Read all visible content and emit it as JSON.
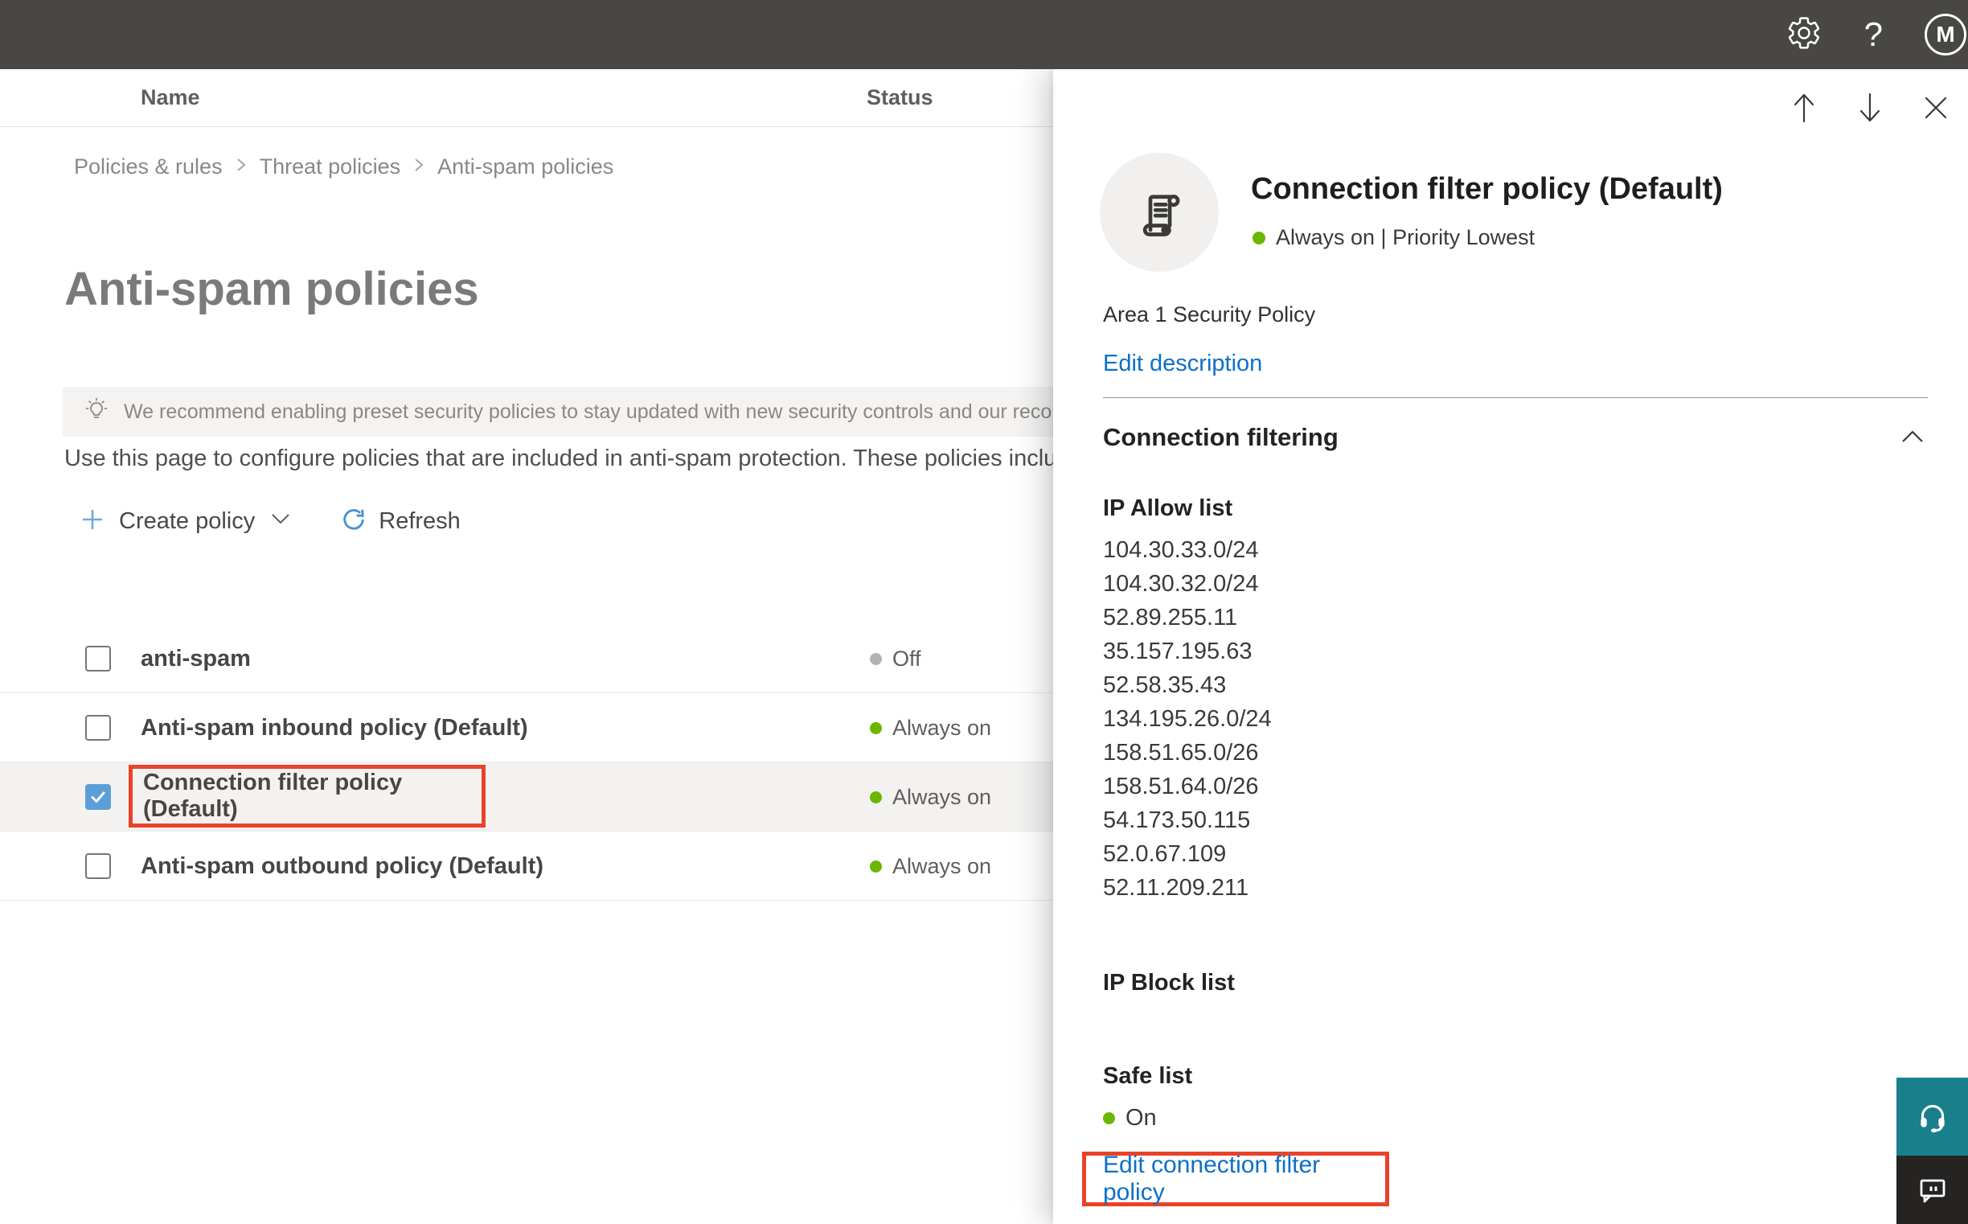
{
  "colors": {
    "topbar_bg": "#494744",
    "accent_blue": "#0d6fc8",
    "status_on_green": "#6bb700",
    "status_off_gray": "#b5b2af",
    "highlight_red": "#e8432a",
    "selected_row_bg": "#f3f2f1",
    "checkbox_checked_blue": "#5c9fd8",
    "support_teal": "#17808b",
    "feedback_dark": "#252423"
  },
  "topbar": {
    "avatar_initial": "M",
    "help_glyph": "?"
  },
  "breadcrumb": {
    "items": [
      "Policies & rules",
      "Threat policies",
      "Anti-spam policies"
    ]
  },
  "page": {
    "title": "Anti-spam policies",
    "banner_text": "We recommend enabling preset security policies to stay updated with new security controls and our recomme",
    "description": "Use this page to configure policies that are included in anti-spam protection. These policies include",
    "toolbar": {
      "create_policy_label": "Create policy",
      "refresh_label": "Refresh"
    }
  },
  "table": {
    "columns": {
      "name": "Name",
      "status": "Status"
    },
    "rows": [
      {
        "name": "anti-spam",
        "status": "Off"
      },
      {
        "name": "Anti-spam inbound policy (Default)",
        "status": "Always on"
      },
      {
        "name": "Connection filter policy (Default)",
        "status": "Always on"
      },
      {
        "name": "Anti-spam outbound policy (Default)",
        "status": "Always on"
      }
    ]
  },
  "panel": {
    "title": "Connection filter policy (Default)",
    "status_line": "Always on | Priority Lowest",
    "description": "Area 1 Security Policy",
    "edit_description_label": "Edit description",
    "section_title": "Connection filtering",
    "ip_allow": {
      "title": "IP Allow list",
      "items": [
        "104.30.33.0/24",
        "104.30.32.0/24",
        "52.89.255.11",
        "35.157.195.63",
        "52.58.35.43",
        "134.195.26.0/24",
        "158.51.65.0/26",
        "158.51.64.0/26",
        "54.173.50.115",
        "52.0.67.109",
        "52.11.209.211"
      ]
    },
    "ip_block": {
      "title": "IP Block list"
    },
    "safe_list": {
      "title": "Safe list",
      "status": "On"
    },
    "edit_link_label": "Edit connection filter policy"
  }
}
